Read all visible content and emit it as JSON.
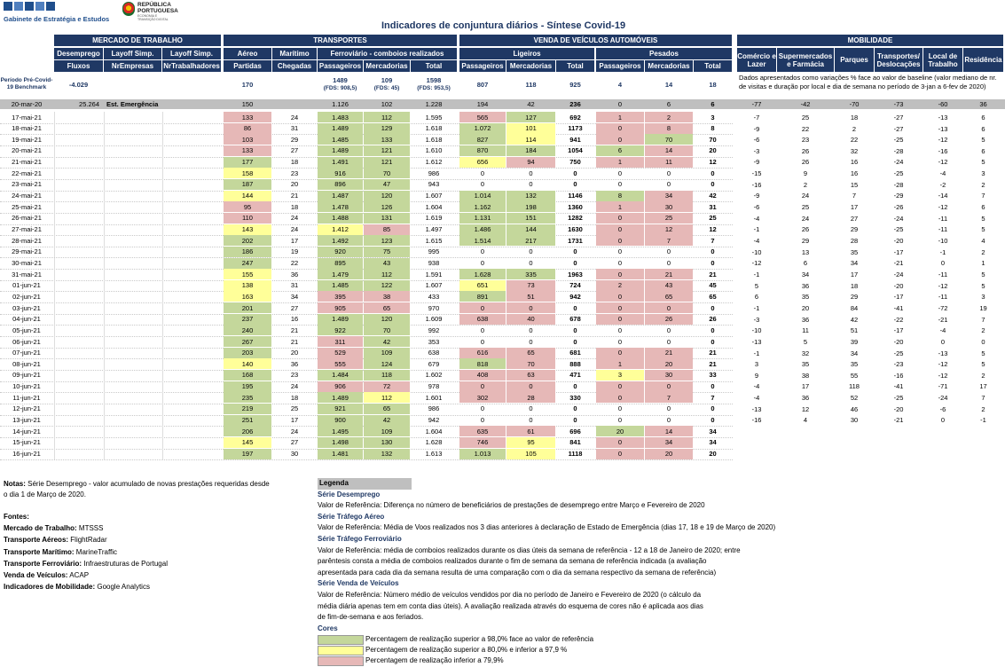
{
  "header": {
    "org_name": "Gabinete de Estratégia e Estudos",
    "rep_line1": "REPÚBLICA",
    "rep_line2": "PORTUGUESA",
    "rep_sub1": "ECONOMIA E",
    "rep_sub2": "TRANSIÇÃO DIGITAL",
    "title": "Indicadores de conjuntura diários - Síntese Covid-19"
  },
  "groups": {
    "mercado": "MERCADO DE TRABALHO",
    "transportes": "TRANSPORTES",
    "veiculos": "VENDA DE VEÍCULOS AUTOMÓVEIS",
    "mobilidade": "MOBILIDADE"
  },
  "subgroups": {
    "desemprego": "Desemprego",
    "layoff1": "Layoff Simp.",
    "layoff2": "Layoff Simp.",
    "aereo": "Aéreo",
    "maritimo": "Marítimo",
    "ferroviario": "Ferroviário - comboios realizados",
    "ligeiros": "Ligeiros",
    "pesados": "Pesados"
  },
  "columns": {
    "fluxos": "Fluxos",
    "nrempresas": "NrEmpresas",
    "nrtrab": "NrTrabalhadores",
    "partidas": "Partidas",
    "chegadas": "Chegadas",
    "f_pass": "Passageiros",
    "f_merc": "Mercadorias",
    "f_total": "Total",
    "l_pass": "Passageiros",
    "l_merc": "Mercadorias",
    "l_total": "Total",
    "p_pass": "Passageiros",
    "p_merc": "Mercadorias",
    "p_total": "Total",
    "comercio": "Comércio e Lazer",
    "supermercados": "Supermercados e Farmácia",
    "parques": "Parques",
    "transportes": "Transportes/ Deslocações",
    "local": "Local de Trabalho",
    "residencia": "Residência"
  },
  "benchmark": {
    "label": "Período Pré-Covid-19 Benchmark",
    "fluxos": "-4.029",
    "partidas": "170",
    "f_pass": "1489",
    "f_pass_sub": "(FDS: 908,5)",
    "f_merc": "109",
    "f_merc_sub": "(FDS: 45)",
    "f_total": "1598",
    "f_total_sub": "(FDS: 953,5)",
    "l_pass": "807",
    "l_merc": "118",
    "l_total": "925",
    "p_pass": "4",
    "p_merc": "14",
    "p_total": "18",
    "mob_note": "Dados apresentados como variações % face ao valor de baseline (valor mediano de nr. de visitas e duração por local e dia de semana no período de 3-jan a 6-fev de 2020)"
  },
  "emergency_row": {
    "date": "20-mar-20",
    "fluxos": "25.264",
    "label": "Est. Emergência",
    "partidas": "150",
    "f_pass": "1.126",
    "f_merc": "102",
    "f_total": "1.228",
    "l_pass": "194",
    "l_merc": "42",
    "l_total": "236",
    "p_pass": "0",
    "p_merc": "6",
    "p_total": "6",
    "m": [
      "-77",
      "-42",
      "-70",
      "-73",
      "-60",
      "36"
    ]
  },
  "rows": [
    {
      "d": "17-mai-21",
      "pa": "133",
      "pac": "p",
      "ch": "24",
      "fp": "1.483",
      "fpc": "g",
      "fm": "112",
      "fmc": "g",
      "ft": "1.595",
      "lp": "565",
      "lpc": "p",
      "lm": "127",
      "lmc": "g",
      "lt": "692",
      "pp": "1",
      "ppc": "p",
      "pm": "2",
      "pmc": "p",
      "pt": "3",
      "m": [
        "-7",
        "25",
        "18",
        "-27",
        "-13",
        "6"
      ]
    },
    {
      "d": "18-mai-21",
      "pa": "86",
      "pac": "p",
      "ch": "31",
      "fp": "1.489",
      "fpc": "g",
      "fm": "129",
      "fmc": "g",
      "ft": "1.618",
      "lp": "1.072",
      "lpc": "g",
      "lm": "101",
      "lmc": "y",
      "lt": "1173",
      "pp": "0",
      "ppc": "p",
      "pm": "8",
      "pmc": "p",
      "pt": "8",
      "m": [
        "-9",
        "22",
        "2",
        "-27",
        "-13",
        "6"
      ]
    },
    {
      "d": "19-mai-21",
      "pa": "103",
      "pac": "p",
      "ch": "29",
      "fp": "1.485",
      "fpc": "g",
      "fm": "133",
      "fmc": "g",
      "ft": "1.618",
      "lp": "827",
      "lpc": "g",
      "lm": "114",
      "lmc": "y",
      "lt": "941",
      "pp": "0",
      "ppc": "p",
      "pm": "70",
      "pmc": "g",
      "pt": "70",
      "m": [
        "-6",
        "23",
        "22",
        "-25",
        "-12",
        "5"
      ]
    },
    {
      "d": "20-mai-21",
      "pa": "133",
      "pac": "p",
      "ch": "27",
      "fp": "1.489",
      "fpc": "g",
      "fm": "121",
      "fmc": "g",
      "ft": "1.610",
      "lp": "870",
      "lpc": "g",
      "lm": "184",
      "lmc": "g",
      "lt": "1054",
      "pp": "6",
      "ppc": "g",
      "pm": "14",
      "pmc": "p",
      "pt": "20",
      "m": [
        "-3",
        "26",
        "32",
        "-28",
        "-16",
        "6"
      ]
    },
    {
      "d": "21-mai-21",
      "pa": "177",
      "pac": "g",
      "ch": "18",
      "fp": "1.491",
      "fpc": "g",
      "fm": "121",
      "fmc": "g",
      "ft": "1.612",
      "lp": "656",
      "lpc": "y",
      "lm": "94",
      "lmc": "p",
      "lt": "750",
      "pp": "1",
      "ppc": "p",
      "pm": "11",
      "pmc": "p",
      "pt": "12",
      "m": [
        "-9",
        "26",
        "16",
        "-24",
        "-12",
        "5"
      ]
    },
    {
      "d": "22-mai-21",
      "pa": "158",
      "pac": "y",
      "ch": "23",
      "fp": "916",
      "fpc": "g",
      "fm": "70",
      "fmc": "g",
      "ft": "986",
      "lp": "0",
      "lpc": "",
      "lm": "0",
      "lmc": "",
      "lt": "0",
      "pp": "0",
      "ppc": "",
      "pm": "0",
      "pmc": "",
      "pt": "0",
      "m": [
        "-15",
        "9",
        "16",
        "-25",
        "-4",
        "3"
      ]
    },
    {
      "d": "23-mai-21",
      "pa": "187",
      "pac": "g",
      "ch": "20",
      "fp": "896",
      "fpc": "g",
      "fm": "47",
      "fmc": "g",
      "ft": "943",
      "lp": "0",
      "lpc": "",
      "lm": "0",
      "lmc": "",
      "lt": "0",
      "pp": "0",
      "ppc": "",
      "pm": "0",
      "pmc": "",
      "pt": "0",
      "m": [
        "-16",
        "2",
        "15",
        "-28",
        "-2",
        "2"
      ]
    },
    {
      "d": "24-mai-21",
      "pa": "144",
      "pac": "y",
      "ch": "21",
      "fp": "1.487",
      "fpc": "g",
      "fm": "120",
      "fmc": "g",
      "ft": "1.607",
      "lp": "1.014",
      "lpc": "g",
      "lm": "132",
      "lmc": "g",
      "lt": "1146",
      "pp": "8",
      "ppc": "g",
      "pm": "34",
      "pmc": "p",
      "pt": "42",
      "m": [
        "-9",
        "24",
        "7",
        "-29",
        "-14",
        "7"
      ]
    },
    {
      "d": "25-mai-21",
      "pa": "95",
      "pac": "p",
      "ch": "18",
      "fp": "1.478",
      "fpc": "g",
      "fm": "126",
      "fmc": "g",
      "ft": "1.604",
      "lp": "1.162",
      "lpc": "g",
      "lm": "198",
      "lmc": "g",
      "lt": "1360",
      "pp": "1",
      "ppc": "p",
      "pm": "30",
      "pmc": "p",
      "pt": "31",
      "m": [
        "-6",
        "25",
        "17",
        "-26",
        "-12",
        "6"
      ]
    },
    {
      "d": "26-mai-21",
      "pa": "110",
      "pac": "p",
      "ch": "24",
      "fp": "1.488",
      "fpc": "g",
      "fm": "131",
      "fmc": "g",
      "ft": "1.619",
      "lp": "1.131",
      "lpc": "g",
      "lm": "151",
      "lmc": "g",
      "lt": "1282",
      "pp": "0",
      "ppc": "p",
      "pm": "25",
      "pmc": "p",
      "pt": "25",
      "m": [
        "-4",
        "24",
        "27",
        "-24",
        "-11",
        "5"
      ]
    },
    {
      "d": "27-mai-21",
      "pa": "143",
      "pac": "y",
      "ch": "24",
      "fp": "1.412",
      "fpc": "y",
      "fm": "85",
      "fmc": "p",
      "ft": "1.497",
      "lp": "1.486",
      "lpc": "g",
      "lm": "144",
      "lmc": "g",
      "lt": "1630",
      "pp": "0",
      "ppc": "p",
      "pm": "12",
      "pmc": "p",
      "pt": "12",
      "m": [
        "-1",
        "26",
        "29",
        "-25",
        "-11",
        "5"
      ]
    },
    {
      "d": "28-mai-21",
      "pa": "202",
      "pac": "g",
      "ch": "17",
      "fp": "1.492",
      "fpc": "g",
      "fm": "123",
      "fmc": "g",
      "ft": "1.615",
      "lp": "1.514",
      "lpc": "g",
      "lm": "217",
      "lmc": "g",
      "lt": "1731",
      "pp": "0",
      "ppc": "p",
      "pm": "7",
      "pmc": "p",
      "pt": "7",
      "m": [
        "-4",
        "29",
        "28",
        "-20",
        "-10",
        "4"
      ]
    },
    {
      "d": "29-mai-21",
      "pa": "186",
      "pac": "g",
      "ch": "19",
      "fp": "920",
      "fpc": "g",
      "fm": "75",
      "fmc": "g",
      "ft": "995",
      "lp": "0",
      "lpc": "",
      "lm": "0",
      "lmc": "",
      "lt": "0",
      "pp": "0",
      "ppc": "",
      "pm": "0",
      "pmc": "",
      "pt": "0",
      "m": [
        "-10",
        "13",
        "35",
        "-17",
        "-1",
        "2"
      ]
    },
    {
      "d": "30-mai-21",
      "pa": "247",
      "pac": "g",
      "ch": "22",
      "fp": "895",
      "fpc": "g",
      "fm": "43",
      "fmc": "g",
      "ft": "938",
      "lp": "0",
      "lpc": "",
      "lm": "0",
      "lmc": "",
      "lt": "0",
      "pp": "0",
      "ppc": "",
      "pm": "0",
      "pmc": "",
      "pt": "0",
      "m": [
        "-12",
        "6",
        "34",
        "-21",
        "0",
        "1"
      ]
    },
    {
      "d": "31-mai-21",
      "pa": "155",
      "pac": "y",
      "ch": "36",
      "fp": "1.479",
      "fpc": "g",
      "fm": "112",
      "fmc": "g",
      "ft": "1.591",
      "lp": "1.628",
      "lpc": "g",
      "lm": "335",
      "lmc": "g",
      "lt": "1963",
      "pp": "0",
      "ppc": "p",
      "pm": "21",
      "pmc": "p",
      "pt": "21",
      "m": [
        "-1",
        "34",
        "17",
        "-24",
        "-11",
        "5"
      ]
    },
    {
      "d": "01-jun-21",
      "pa": "138",
      "pac": "y",
      "ch": "31",
      "fp": "1.485",
      "fpc": "g",
      "fm": "122",
      "fmc": "g",
      "ft": "1.607",
      "lp": "651",
      "lpc": "y",
      "lm": "73",
      "lmc": "p",
      "lt": "724",
      "pp": "2",
      "ppc": "p",
      "pm": "43",
      "pmc": "p",
      "pt": "45",
      "m": [
        "5",
        "36",
        "18",
        "-20",
        "-12",
        "5"
      ]
    },
    {
      "d": "02-jun-21",
      "pa": "163",
      "pac": "y",
      "ch": "34",
      "fp": "395",
      "fpc": "p",
      "fm": "38",
      "fmc": "p",
      "ft": "433",
      "lp": "891",
      "lpc": "g",
      "lm": "51",
      "lmc": "p",
      "lt": "942",
      "pp": "0",
      "ppc": "p",
      "pm": "65",
      "pmc": "p",
      "pt": "65",
      "m": [
        "6",
        "35",
        "29",
        "-17",
        "-11",
        "3"
      ]
    },
    {
      "d": "03-jun-21",
      "pa": "201",
      "pac": "g",
      "ch": "27",
      "fp": "905",
      "fpc": "p",
      "fm": "65",
      "fmc": "p",
      "ft": "970",
      "lp": "0",
      "lpc": "p",
      "lm": "0",
      "lmc": "p",
      "lt": "0",
      "pp": "0",
      "ppc": "p",
      "pm": "0",
      "pmc": "p",
      "pt": "0",
      "m": [
        "-1",
        "20",
        "84",
        "-41",
        "-72",
        "19"
      ]
    },
    {
      "d": "04-jun-21",
      "pa": "237",
      "pac": "g",
      "ch": "16",
      "fp": "1.489",
      "fpc": "g",
      "fm": "120",
      "fmc": "g",
      "ft": "1.609",
      "lp": "638",
      "lpc": "p",
      "lm": "40",
      "lmc": "p",
      "lt": "678",
      "pp": "0",
      "ppc": "p",
      "pm": "26",
      "pmc": "p",
      "pt": "26",
      "m": [
        "-3",
        "36",
        "42",
        "-22",
        "-21",
        "7"
      ]
    },
    {
      "d": "05-jun-21",
      "pa": "240",
      "pac": "g",
      "ch": "21",
      "fp": "922",
      "fpc": "g",
      "fm": "70",
      "fmc": "g",
      "ft": "992",
      "lp": "0",
      "lpc": "",
      "lm": "0",
      "lmc": "",
      "lt": "0",
      "pp": "0",
      "ppc": "",
      "pm": "0",
      "pmc": "",
      "pt": "0",
      "m": [
        "-10",
        "11",
        "51",
        "-17",
        "-4",
        "2"
      ]
    },
    {
      "d": "06-jun-21",
      "pa": "267",
      "pac": "g",
      "ch": "21",
      "fp": "311",
      "fpc": "p",
      "fm": "42",
      "fmc": "g",
      "ft": "353",
      "lp": "0",
      "lpc": "",
      "lm": "0",
      "lmc": "",
      "lt": "0",
      "pp": "0",
      "ppc": "",
      "pm": "0",
      "pmc": "",
      "pt": "0",
      "m": [
        "-13",
        "5",
        "39",
        "-20",
        "0",
        "0"
      ]
    },
    {
      "d": "07-jun-21",
      "pa": "203",
      "pac": "g",
      "ch": "20",
      "fp": "529",
      "fpc": "p",
      "fm": "109",
      "fmc": "g",
      "ft": "638",
      "lp": "616",
      "lpc": "p",
      "lm": "65",
      "lmc": "p",
      "lt": "681",
      "pp": "0",
      "ppc": "p",
      "pm": "21",
      "pmc": "p",
      "pt": "21",
      "m": [
        "-1",
        "32",
        "34",
        "-25",
        "-13",
        "5"
      ]
    },
    {
      "d": "08-jun-21",
      "pa": "140",
      "pac": "y",
      "ch": "36",
      "fp": "555",
      "fpc": "p",
      "fm": "124",
      "fmc": "g",
      "ft": "679",
      "lp": "818",
      "lpc": "g",
      "lm": "70",
      "lmc": "p",
      "lt": "888",
      "pp": "1",
      "ppc": "p",
      "pm": "20",
      "pmc": "p",
      "pt": "21",
      "m": [
        "3",
        "35",
        "35",
        "-23",
        "-12",
        "5"
      ]
    },
    {
      "d": "09-jun-21",
      "pa": "168",
      "pac": "g",
      "ch": "23",
      "fp": "1.484",
      "fpc": "g",
      "fm": "118",
      "fmc": "g",
      "ft": "1.602",
      "lp": "408",
      "lpc": "p",
      "lm": "63",
      "lmc": "p",
      "lt": "471",
      "pp": "3",
      "ppc": "y",
      "pm": "30",
      "pmc": "p",
      "pt": "33",
      "m": [
        "9",
        "38",
        "55",
        "-16",
        "-12",
        "2"
      ]
    },
    {
      "d": "10-jun-21",
      "pa": "195",
      "pac": "g",
      "ch": "24",
      "fp": "906",
      "fpc": "p",
      "fm": "72",
      "fmc": "p",
      "ft": "978",
      "lp": "0",
      "lpc": "p",
      "lm": "0",
      "lmc": "p",
      "lt": "0",
      "pp": "0",
      "ppc": "p",
      "pm": "0",
      "pmc": "p",
      "pt": "0",
      "m": [
        "-4",
        "17",
        "118",
        "-41",
        "-71",
        "17"
      ]
    },
    {
      "d": "11-jun-21",
      "pa": "235",
      "pac": "g",
      "ch": "18",
      "fp": "1.489",
      "fpc": "g",
      "fm": "112",
      "fmc": "y",
      "ft": "1.601",
      "lp": "302",
      "lpc": "p",
      "lm": "28",
      "lmc": "p",
      "lt": "330",
      "pp": "0",
      "ppc": "p",
      "pm": "7",
      "pmc": "p",
      "pt": "7",
      "m": [
        "-4",
        "36",
        "52",
        "-25",
        "-24",
        "7"
      ]
    },
    {
      "d": "12-jun-21",
      "pa": "219",
      "pac": "g",
      "ch": "25",
      "fp": "921",
      "fpc": "g",
      "fm": "65",
      "fmc": "g",
      "ft": "986",
      "lp": "0",
      "lpc": "",
      "lm": "0",
      "lmc": "",
      "lt": "0",
      "pp": "0",
      "ppc": "",
      "pm": "0",
      "pmc": "",
      "pt": "0",
      "m": [
        "-13",
        "12",
        "46",
        "-20",
        "-6",
        "2"
      ]
    },
    {
      "d": "13-jun-21",
      "pa": "251",
      "pac": "g",
      "ch": "17",
      "fp": "900",
      "fpc": "g",
      "fm": "42",
      "fmc": "g",
      "ft": "942",
      "lp": "0",
      "lpc": "",
      "lm": "0",
      "lmc": "",
      "lt": "0",
      "pp": "0",
      "ppc": "",
      "pm": "0",
      "pmc": "",
      "pt": "0",
      "m": [
        "-16",
        "4",
        "30",
        "-21",
        "0",
        "-1"
      ]
    },
    {
      "d": "14-jun-21",
      "pa": "206",
      "pac": "g",
      "ch": "24",
      "fp": "1.495",
      "fpc": "g",
      "fm": "109",
      "fmc": "g",
      "ft": "1.604",
      "lp": "635",
      "lpc": "p",
      "lm": "61",
      "lmc": "p",
      "lt": "696",
      "pp": "20",
      "ppc": "g",
      "pm": "14",
      "pmc": "p",
      "pt": "34",
      "m": [
        "",
        "",
        "",
        "",
        "",
        ""
      ]
    },
    {
      "d": "15-jun-21",
      "pa": "145",
      "pac": "y",
      "ch": "27",
      "fp": "1.498",
      "fpc": "g",
      "fm": "130",
      "fmc": "g",
      "ft": "1.628",
      "lp": "746",
      "lpc": "p",
      "lm": "95",
      "lmc": "y",
      "lt": "841",
      "pp": "0",
      "ppc": "p",
      "pm": "34",
      "pmc": "p",
      "pt": "34",
      "m": [
        "",
        "",
        "",
        "",
        "",
        ""
      ]
    },
    {
      "d": "16-jun-21",
      "pa": "197",
      "pac": "g",
      "ch": "30",
      "fp": "1.481",
      "fpc": "g",
      "fm": "132",
      "fmc": "g",
      "ft": "1.613",
      "lp": "1.013",
      "lpc": "g",
      "lm": "105",
      "lmc": "y",
      "lt": "1118",
      "pp": "0",
      "ppc": "p",
      "pm": "20",
      "pmc": "p",
      "pt": "20",
      "m": [
        "",
        "",
        "",
        "",
        "",
        ""
      ]
    }
  ],
  "notes": {
    "prefix": "Notas:",
    "text": " Série Desemprego - valor acumulado de novas prestações requeridas desde o dia 1 de Março de 2020."
  },
  "fontes": {
    "title": "Fontes:",
    "items": [
      {
        "k": "Mercado de Trabalho:",
        "v": " MTSSS"
      },
      {
        "k": "Transporte Aéreos:",
        "v": " FlightRadar"
      },
      {
        "k": "Transporte Marítimo:",
        "v": " MarineTraffic"
      },
      {
        "k": "Transporte Ferroviário:",
        "v": " Infraestruturas de Portugal"
      },
      {
        "k": "Venda de Veículos:",
        "v": " ACAP"
      },
      {
        "k": "Indicadores de Mobilidade:",
        "v": " Google Analytics"
      }
    ]
  },
  "legend": {
    "title": "Legenda",
    "desemprego_title": "Série Desemprego",
    "desemprego_text": "Valor de Referência: Diferença no número de beneficiários de prestações de desemprego entre Março e Fevereiro de 2020",
    "aereo_title": "Série Tráfego Aéreo",
    "aereo_text": "Valor de Referência: Média de Voos realizados nos 3 dias anteriores à declaração de Estado de Emergência (dias 17, 18 e 19 de Março de 2020)",
    "ferro_title": "Série Tráfego Ferroviário",
    "ferro_text1": "Valor de Referência: média de comboios realizados durante os dias úteis da semana de referência - 12 a 18 de Janeiro de 2020; entre",
    "ferro_text2": "parêntesis consta a média de comboios realizados durante o fim de semana da semana de referência indicada (a avaliação",
    "ferro_text3": "apresentada para cada dia da semana resulta de uma comparação com o dia da semana respectivo da semana de referência)",
    "veic_title": "Série Venda de Veículos",
    "veic_text1": "Valor de Referência: Número médio de veículos vendidos por dia no período de Janeiro e Fevereiro de 2020 (o cálculo da",
    "veic_text2": "média diária apenas tem em conta dias úteis). A avaliação realizada através do esquema de cores não é aplicada aos dias",
    "veic_text3": "de fim-de-semana e aos feriados.",
    "cores_title": "Cores",
    "cor_green": "Percentagem de realização superior a 98,0% face ao valor de referência",
    "cor_yellow": "Percentagem de realização superior a 80,0% e inferior a 97,9 %",
    "cor_pink": "Percentagem de realização inferior a 79,9%"
  },
  "colors": {
    "header_bg": "#1f3864",
    "green": "#c4d79b",
    "yellow": "#ffff99",
    "pink": "#e6b8b7",
    "gray": "#bfbfbf"
  }
}
